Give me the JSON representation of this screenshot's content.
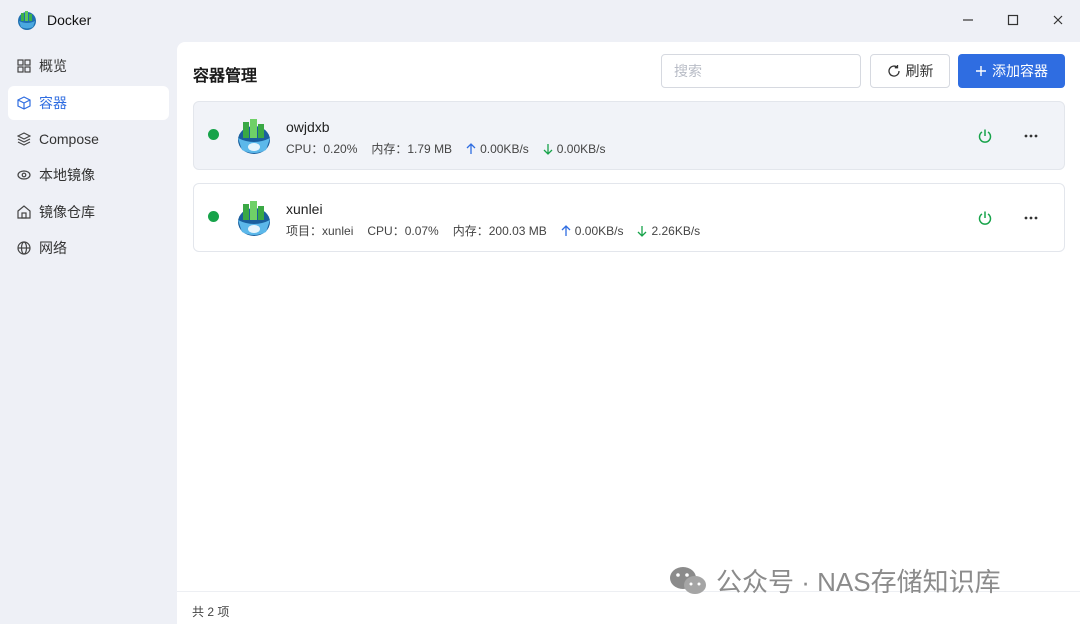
{
  "window": {
    "title": "Docker"
  },
  "sidebar": {
    "items": [
      {
        "label": "概览",
        "icon": "grid-icon"
      },
      {
        "label": "容器",
        "icon": "cube-icon",
        "active": true
      },
      {
        "label": "Compose",
        "icon": "layers-icon"
      },
      {
        "label": "本地镜像",
        "icon": "eye-icon"
      },
      {
        "label": "镜像仓库",
        "icon": "house-icon"
      },
      {
        "label": "网络",
        "icon": "globe-icon"
      }
    ]
  },
  "main": {
    "title": "容器管理",
    "search_placeholder": "搜索",
    "refresh_label": "刷新",
    "add_label": "添加容器",
    "containers": [
      {
        "name": "owjdxb",
        "status": "running",
        "cpu": "CPU：0.20%",
        "memory": "内存：1.79 MB",
        "upload": "0.00KB/s",
        "download": "0.00KB/s"
      },
      {
        "name": "xunlei",
        "status": "running",
        "project": "项目：xunlei",
        "cpu": "CPU：0.07%",
        "memory": "内存：200.03 MB",
        "upload": "0.00KB/s",
        "download": "2.26KB/s"
      }
    ],
    "footer": "共 2 项"
  },
  "watermark": {
    "text": "公众号 · NAS存储知识库"
  },
  "colors": {
    "accent": "#2f6de1",
    "running": "#17a34a",
    "background": "#eef0f6"
  }
}
